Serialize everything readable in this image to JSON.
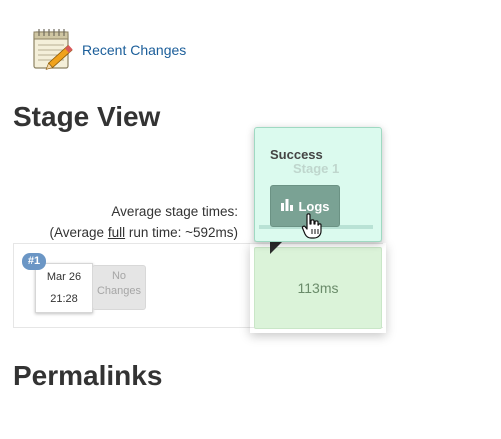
{
  "recent_changes": {
    "label": "Recent Changes"
  },
  "sections": {
    "stage_view_title": "Stage View",
    "permalinks_title": "Permalinks"
  },
  "stage_table": {
    "average_label": "Average stage times:",
    "average_full_prefix": "(Average ",
    "average_full_word": "full",
    "average_full_suffix": " run time: ~592ms)",
    "stage_header_ghost_time": "ms"
  },
  "build": {
    "badge": "#1",
    "date": "Mar 26",
    "time": "21:28",
    "changes_line1": "No",
    "changes_line2": "Changes"
  },
  "stage_cell": {
    "duration": "113ms",
    "status_color": "#dbf3d9"
  },
  "popup": {
    "status": "Success",
    "stage_name": "Stage 1",
    "logs_label": "Logs",
    "logs_icon": "bar-chart-icon"
  }
}
